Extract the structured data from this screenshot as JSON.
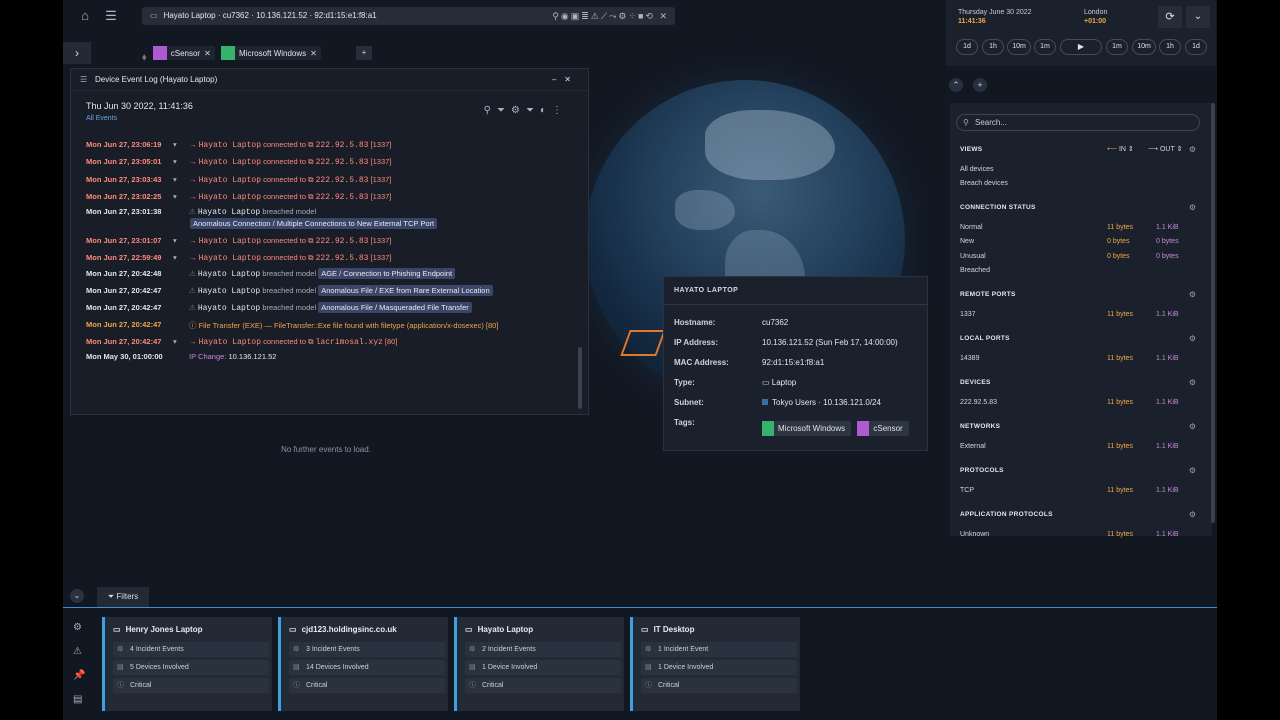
{
  "toolbar": {
    "address": "Hayato Laptop · cu7362 · 10.136.121.52 · 92:d1:15:e1:f8:a1"
  },
  "tags": [
    {
      "label": "cSensor",
      "color": "#b05ad1"
    },
    {
      "label": "Microsoft Windows",
      "color": "#34b46a"
    }
  ],
  "tag_add": "+",
  "event_log": {
    "title": "Device Event Log (Hayato Laptop)",
    "current_time": "Thu Jun 30 2022, 11:41:36",
    "filter_label": "All Events",
    "events": [
      {
        "time": "Mon Jun 27, 23:06:19",
        "kind": "conn",
        "device": "Hayato Laptop",
        "verb": "connected to",
        "target": "222.92.5.83",
        "port": "[1337]"
      },
      {
        "time": "Mon Jun 27, 23:05:01",
        "kind": "conn",
        "device": "Hayato Laptop",
        "verb": "connected to",
        "target": "222.92.5.83",
        "port": "[1337]"
      },
      {
        "time": "Mon Jun 27, 23:03:43",
        "kind": "conn",
        "device": "Hayato Laptop",
        "verb": "connected to",
        "target": "222.92.5.83",
        "port": "[1337]"
      },
      {
        "time": "Mon Jun 27, 23:02:25",
        "kind": "conn",
        "device": "Hayato Laptop",
        "verb": "connected to",
        "target": "222.92.5.83",
        "port": "[1337]"
      },
      {
        "time": "Mon Jun 27, 23:01:38",
        "kind": "breach",
        "device": "Hayato Laptop",
        "verb": "breached model",
        "model": "Anomalous Connection / Multiple Connections to New External TCP Port"
      },
      {
        "time": "Mon Jun 27, 23:01:07",
        "kind": "conn",
        "device": "Hayato Laptop",
        "verb": "connected to",
        "target": "222.92.5.83",
        "port": "[1337]"
      },
      {
        "time": "Mon Jun 27, 22:59:49",
        "kind": "conn",
        "device": "Hayato Laptop",
        "verb": "connected to",
        "target": "222.92.5.83",
        "port": "[1337]"
      },
      {
        "time": "Mon Jun 27, 20:42:48",
        "kind": "breach",
        "device": "Hayato Laptop",
        "verb": "breached model",
        "model": "AGE / Connection to Phishing Endpoint"
      },
      {
        "time": "Mon Jun 27, 20:42:47",
        "kind": "breach",
        "device": "Hayato Laptop",
        "verb": "breached model",
        "model": "Anomalous File / EXE from Rare External Location"
      },
      {
        "time": "Mon Jun 27, 20:42:47",
        "kind": "breach",
        "device": "Hayato Laptop",
        "verb": "breached model",
        "model": "Anomalous File / Masqueraded File Transfer"
      },
      {
        "time": "Mon Jun 27, 20:42:47",
        "kind": "file",
        "text": "File Transfer (EXE) —  FileTransfer::Exe file found with filetype (application/x-dosexec)  [80]"
      },
      {
        "time": "Mon Jun 27, 20:42:47",
        "kind": "conn",
        "device": "Hayato Laptop",
        "verb": "connected to",
        "target": "lacrimosal.xyz",
        "port": "[80]"
      },
      {
        "time": "Mon May 30, 01:00:00",
        "kind": "ip",
        "label": "IP Change:",
        "value": "10.136.121.52"
      }
    ],
    "no_more": "No further events to load."
  },
  "device_popup": {
    "title": "HAYATO LAPTOP",
    "fields": [
      {
        "key": "Hostname:",
        "value": "cu7362"
      },
      {
        "key": "IP Address:",
        "value": "10.136.121.52 (Sun Feb 17, 14:00:00)"
      },
      {
        "key": "MAC Address:",
        "value": "92:d1:15:e1:f8:a1"
      },
      {
        "key": "Type:",
        "value": "Laptop"
      },
      {
        "key": "Subnet:",
        "value": "Tokyo Users · 10.136.121.0/24"
      },
      {
        "key": "Tags:",
        "value": ""
      }
    ],
    "tags": [
      {
        "label": "Microsoft Windows",
        "color": "#34b46a"
      },
      {
        "label": "cSensor",
        "color": "#b05ad1"
      }
    ]
  },
  "time_panel": {
    "local_date": "Thursday June 30 2022",
    "local_time": "11:41:36",
    "remote_city": "London",
    "remote_offset": "+01:00",
    "buttons": [
      "1d",
      "1h",
      "10m",
      "1m",
      "1m",
      "10m",
      "1h",
      "1d"
    ]
  },
  "right_panel": {
    "search_placeholder": "Search...",
    "in_label": "IN",
    "out_label": "OUT",
    "views": {
      "title": "VIEWS",
      "items": [
        "All devices",
        "Breach devices"
      ]
    },
    "sections": [
      {
        "title": "CONNECTION STATUS",
        "rows": [
          {
            "name": "Normal",
            "in": "11 bytes",
            "out": "1.1 KiB"
          },
          {
            "name": "New",
            "in": "0 bytes",
            "out": "0 bytes"
          },
          {
            "name": "Unusual",
            "in": "0 bytes",
            "out": "0 bytes"
          },
          {
            "name": "Breached",
            "in": "",
            "out": ""
          }
        ]
      },
      {
        "title": "REMOTE PORTS",
        "rows": [
          {
            "name": "1337",
            "in": "11 bytes",
            "out": "1.1 KiB"
          }
        ]
      },
      {
        "title": "LOCAL PORTS",
        "rows": [
          {
            "name": "14389",
            "in": "11 bytes",
            "out": "1.1 KiB"
          }
        ]
      },
      {
        "title": "DEVICES",
        "rows": [
          {
            "name": "222.92.5.83",
            "in": "11 bytes",
            "out": "1.1 KiB"
          }
        ]
      },
      {
        "title": "NETWORKS",
        "rows": [
          {
            "name": "External",
            "in": "11 bytes",
            "out": "1.1 KiB"
          }
        ]
      },
      {
        "title": "PROTOCOLS",
        "rows": [
          {
            "name": "TCP",
            "in": "11 bytes",
            "out": "1.1 KiB"
          }
        ]
      },
      {
        "title": "APPLICATION PROTOCOLS",
        "rows": [
          {
            "name": "Unknown",
            "in": "11 bytes",
            "out": "1.1 KiB"
          }
        ]
      }
    ]
  },
  "bottom": {
    "filters_label": "Filters",
    "cards": [
      {
        "title": "Henry Jones Laptop",
        "incidents": "4 Incident Events",
        "devices": "5 Devices Involved",
        "severity": "Critical"
      },
      {
        "title": "cjd123.holdingsinc.co.uk",
        "incidents": "3 Incident Events",
        "devices": "14 Devices Involved",
        "severity": "Critical"
      },
      {
        "title": "Hayato Laptop",
        "incidents": "2 Incident Events",
        "devices": "1 Device Involved",
        "severity": "Critical"
      },
      {
        "title": "IT Desktop",
        "incidents": "1 Incident Event",
        "devices": "1 Device Involved",
        "severity": "Critical"
      }
    ]
  },
  "colors": {
    "accent": "#3fa0e0",
    "alert": "#ff8a7a",
    "bytes_in": "#f0a645",
    "bytes_out": "#c68bd7"
  }
}
